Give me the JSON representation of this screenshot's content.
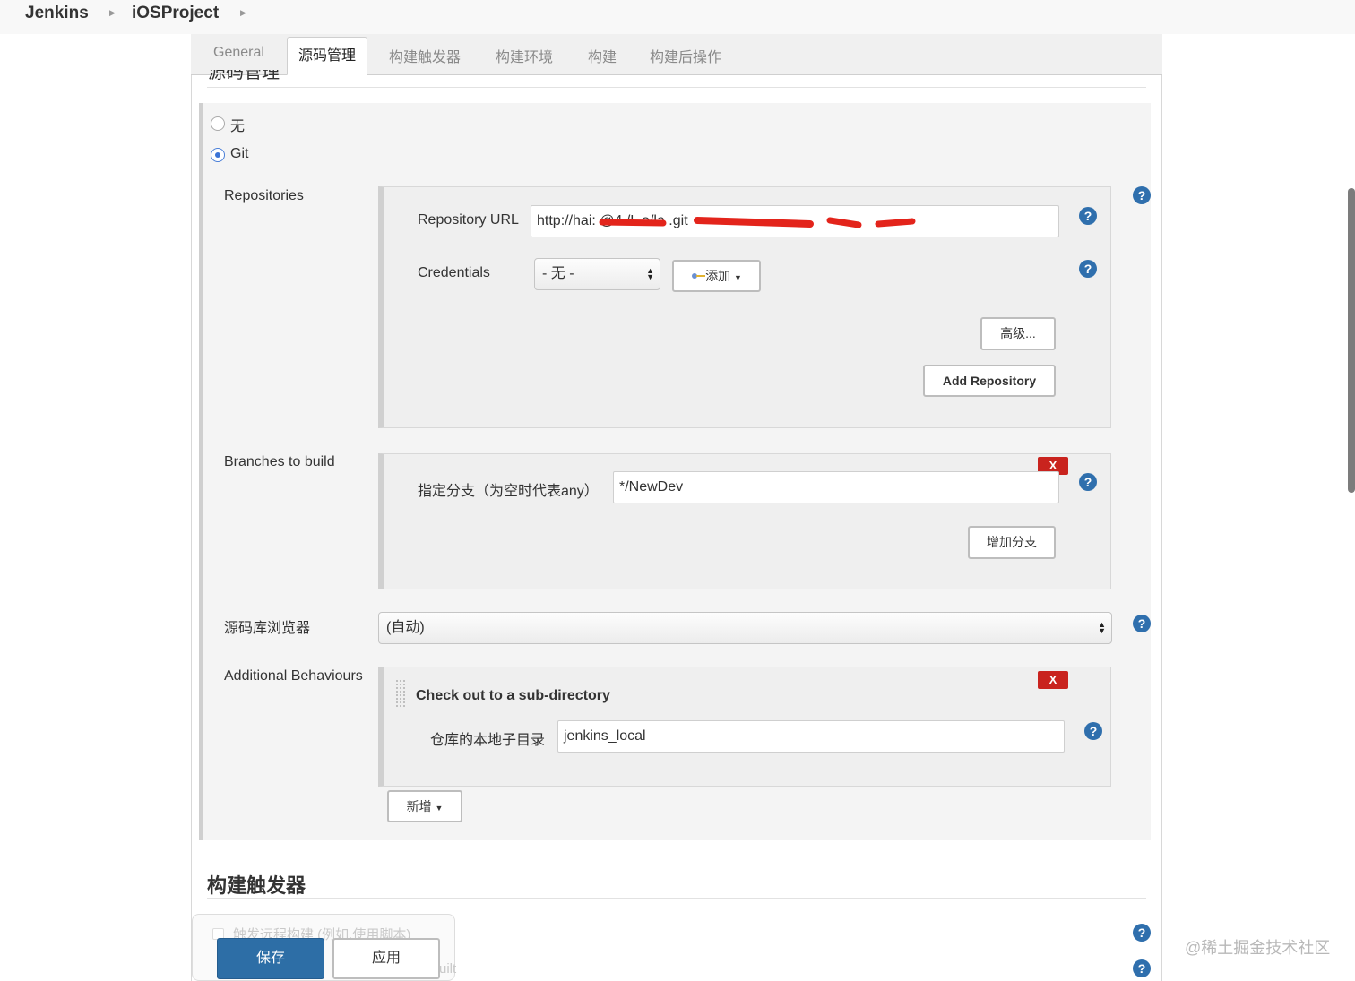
{
  "breadcrumb": {
    "items": [
      "Jenkins",
      "iOSProject"
    ]
  },
  "tabs": {
    "items": [
      "General",
      "源码管理",
      "构建触发器",
      "构建环境",
      "构建",
      "构建后操作"
    ],
    "active": "源码管理"
  },
  "scm": {
    "section_title": "源码管理",
    "options": {
      "none": "无",
      "git": "Git"
    },
    "selected": "Git"
  },
  "repositories": {
    "label": "Repositories",
    "url_label": "Repository URL",
    "url_value": "http://hai:        @4              /L     o/la      .git",
    "credentials_label": "Credentials",
    "credentials_selected": "- 无 -",
    "add_label": "添加",
    "advanced_label": "高级...",
    "add_repository_label": "Add Repository"
  },
  "branches": {
    "label": "Branches to build",
    "branch_label": "指定分支（为空时代表any）",
    "branch_value": "*/NewDev",
    "delete_label": "X",
    "add_branch_label": "增加分支"
  },
  "browser": {
    "label": "源码库浏览器",
    "selected": "(自动)"
  },
  "behaviours": {
    "label": "Additional Behaviours",
    "item_title": "Check out to a sub-directory",
    "delete_label": "X",
    "field_label": "仓库的本地子目录",
    "field_value": "jenkins_local",
    "new_label": "新增"
  },
  "triggers": {
    "title": "构建触发器",
    "remote_label": "触发远程构建 (例如,使用脚本)",
    "faded_tail": "uilt"
  },
  "actions": {
    "save": "保存",
    "apply": "应用"
  },
  "help": {
    "symbol": "?"
  },
  "watermark": "@稀土掘金技术社区",
  "colors": {
    "primary": "#2d6ea6",
    "help": "#2f6fad",
    "delete": "#c9231e",
    "radio_selected": "#3b74d6"
  }
}
